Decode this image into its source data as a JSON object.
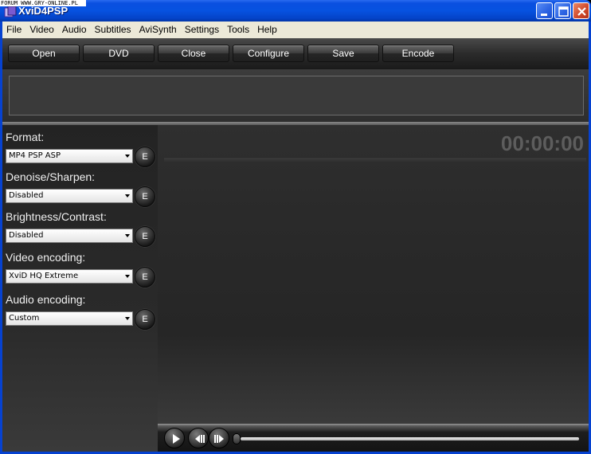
{
  "watermark": "FORUM WWW.GRY-ONLINE.PL",
  "window": {
    "title": "XviD4PSP"
  },
  "menu": [
    "File",
    "Video",
    "Audio",
    "Subtitles",
    "AviSynth",
    "Settings",
    "Tools",
    "Help"
  ],
  "toolbar": {
    "open": "Open",
    "dvd": "DVD",
    "close": "Close",
    "configure": "Configure",
    "save": "Save",
    "encode": "Encode"
  },
  "settings": {
    "format_label": "Format:",
    "format_value": "MP4 PSP ASP",
    "denoise_label": "Denoise/Sharpen:",
    "denoise_value": "Disabled",
    "brightness_label": "Brightness/Contrast:",
    "brightness_value": "Disabled",
    "video_label": "Video encoding:",
    "video_value": "XviD HQ Extreme",
    "audio_label": "Audio encoding:",
    "audio_value": "Custom",
    "edit_label": "E"
  },
  "preview": {
    "timecode": "00:00:00"
  },
  "player": {
    "seek_position": 0
  },
  "colors": {
    "titlebar": "#0652e0",
    "close_button": "#d24b2c",
    "panel_bg": "#2a2a2a",
    "timecode": "#5d5d5d"
  }
}
